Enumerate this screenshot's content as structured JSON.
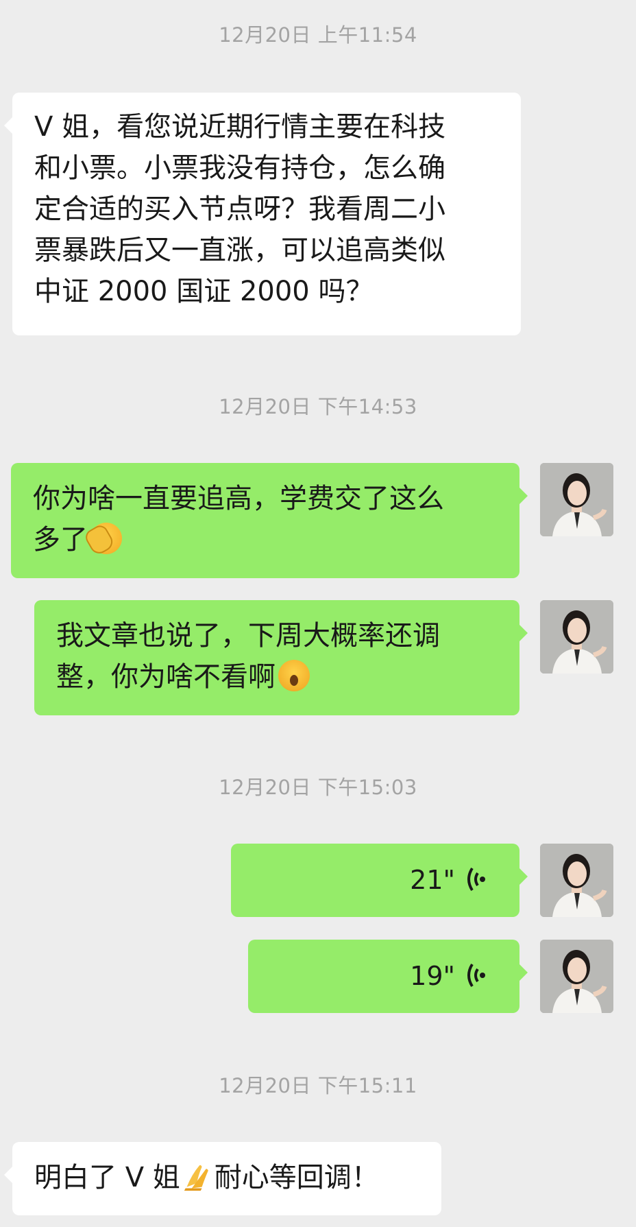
{
  "messages": [
    {
      "time": "12月20日 上午11:54"
    },
    {
      "incoming_1": "V 姐，看您说近期行情主要在科技和小票。小票我没有持仓，怎么确定合适的买入节点呀？我看周二小票暴跌后又一直涨，可以追高类似中证 2000 国证 2000 吗？"
    }
  ],
  "chat": {
    "time_1": "12月20日 上午11:54",
    "msg_in_1_lines": [
      "V 姐，看您说近期行情主要在科技",
      "和小票。小票我没有持仓，怎么确",
      "定合适的买入节点呀？我看周二小",
      "票暴跌后又一直涨，可以追高类似",
      "中证 2000 国证 2000 吗？"
    ],
    "time_2": "12月20日 下午14:53",
    "msg_out_1_line1": "你为啥一直要追高，学费交了这么",
    "msg_out_1_line2": "多了",
    "msg_out_2_line1": "我文章也说了，下周大概率还调",
    "msg_out_2_line2": "整，你为啥不看啊",
    "time_3": "12月20日 下午15:03",
    "voice_1_duration": "21\"",
    "voice_2_duration": "19\"",
    "time_4": "12月20日 下午15:11",
    "msg_in_2_part1": "明白了 V 姐",
    "msg_in_2_part2": "耐心等回调！"
  },
  "emoji": {
    "facepalm": "facepalm-emoji",
    "gasp": "surprised-emoji",
    "pray": "praying-hands-emoji"
  },
  "colors": {
    "background": "#ededed",
    "outgoing_bubble": "#95ec69",
    "incoming_bubble": "#ffffff",
    "timestamp": "#a3a3a3"
  }
}
